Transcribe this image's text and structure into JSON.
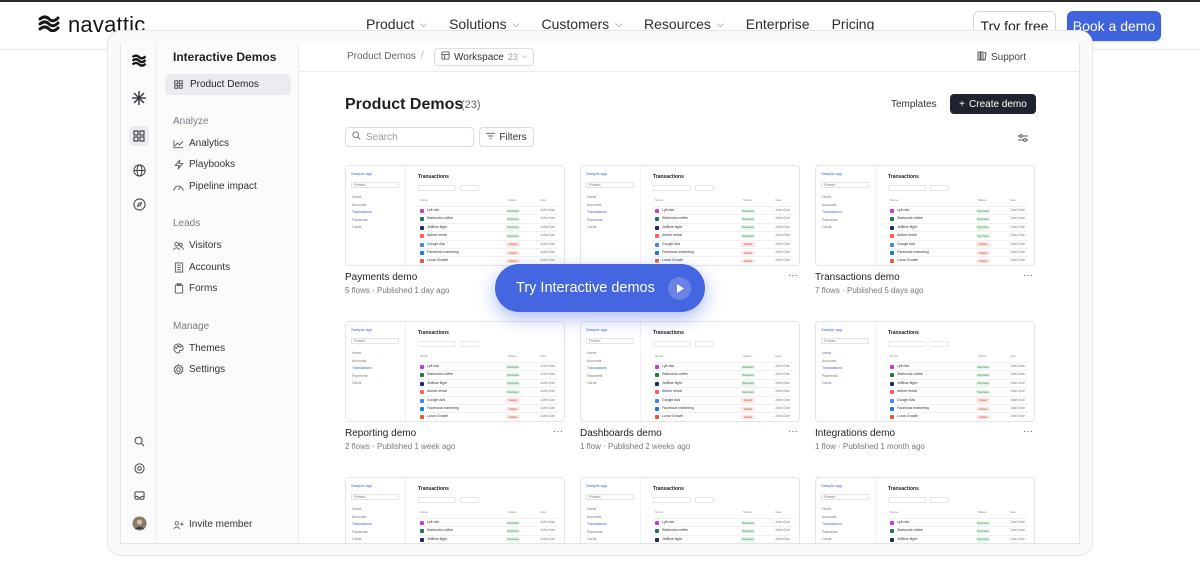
{
  "header": {
    "brand": "navattic",
    "nav": [
      {
        "label": "Product",
        "dropdown": true
      },
      {
        "label": "Solutions",
        "dropdown": true
      },
      {
        "label": "Customers",
        "dropdown": true
      },
      {
        "label": "Resources",
        "dropdown": true
      },
      {
        "label": "Enterprise",
        "dropdown": false
      },
      {
        "label": "Pricing",
        "dropdown": false
      }
    ],
    "try_label": "Try for free",
    "book_label": "Book a demo",
    "accent": "#3e63dd"
  },
  "sidebar": {
    "title": "Interactive Demos",
    "selected": "Product Demos",
    "sections": {
      "analyze": "Analyze",
      "leads": "Leads",
      "manage": "Manage"
    },
    "items": {
      "analytics": "Analytics",
      "playbooks": "Playbooks",
      "pipeline": "Pipeline impact",
      "visitors": "Visitors",
      "accounts": "Accounts",
      "forms": "Forms",
      "themes": "Themes",
      "settings": "Settings",
      "invite": "Invite member"
    }
  },
  "main": {
    "breadcrumb": "Product Demos",
    "workspace_label": "Workspace",
    "workspace_count": "23",
    "support": "Support",
    "title": "Product Demos",
    "count": "(23)",
    "templates": "Templates",
    "create": "Create demo",
    "search_placeholder": "Search",
    "filters": "Filters"
  },
  "thumb": {
    "app": "Sample app",
    "select": "Fintech",
    "nav": [
      "Home",
      "Accounts",
      "Transactions",
      "Payments",
      "Cards"
    ],
    "title": "Transactions",
    "columns": [
      "Name",
      "Status",
      "User"
    ],
    "rows": [
      {
        "name": "Lyft ride",
        "status": "Success",
        "user": "John Doe",
        "color": "#c13bd8"
      },
      {
        "name": "Starbucks coffee",
        "status": "Success",
        "user": "John Doe",
        "color": "#1e7a4a"
      },
      {
        "name": "JetBlue flight",
        "status": "Success",
        "user": "John Doe",
        "color": "#1a2a6c"
      },
      {
        "name": "Airbnb rental",
        "status": "Success",
        "user": "John Doe",
        "color": "#ff5a5f"
      },
      {
        "name": "Google Ads",
        "status": "Failed",
        "user": "John Doe",
        "color": "#4285f4"
      },
      {
        "name": "Facebook marketing",
        "status": "Failed",
        "user": "John Doe",
        "color": "#1877f2"
      },
      {
        "name": "Lunar Growth",
        "status": "Failed",
        "user": "John Doe",
        "color": "#e5592e"
      }
    ]
  },
  "cards": [
    {
      "name": "Payments demo",
      "meta": "5 flows · Published 1 day ago"
    },
    {
      "name": "",
      "meta": ""
    },
    {
      "name": "Transactions demo",
      "meta": "7 flows · Published 5 days ago"
    },
    {
      "name": "Reporting demo",
      "meta": "2 flows · Published 1 week ago"
    },
    {
      "name": "Dashboards demo",
      "meta": "1 flow · Published 2 weeks ago"
    },
    {
      "name": "Integrations demo",
      "meta": "1 flow · Published 1 month ago"
    },
    {
      "name": "",
      "meta": ""
    },
    {
      "name": "",
      "meta": ""
    },
    {
      "name": "",
      "meta": ""
    }
  ],
  "cta": {
    "label": "Try Interactive demos"
  }
}
